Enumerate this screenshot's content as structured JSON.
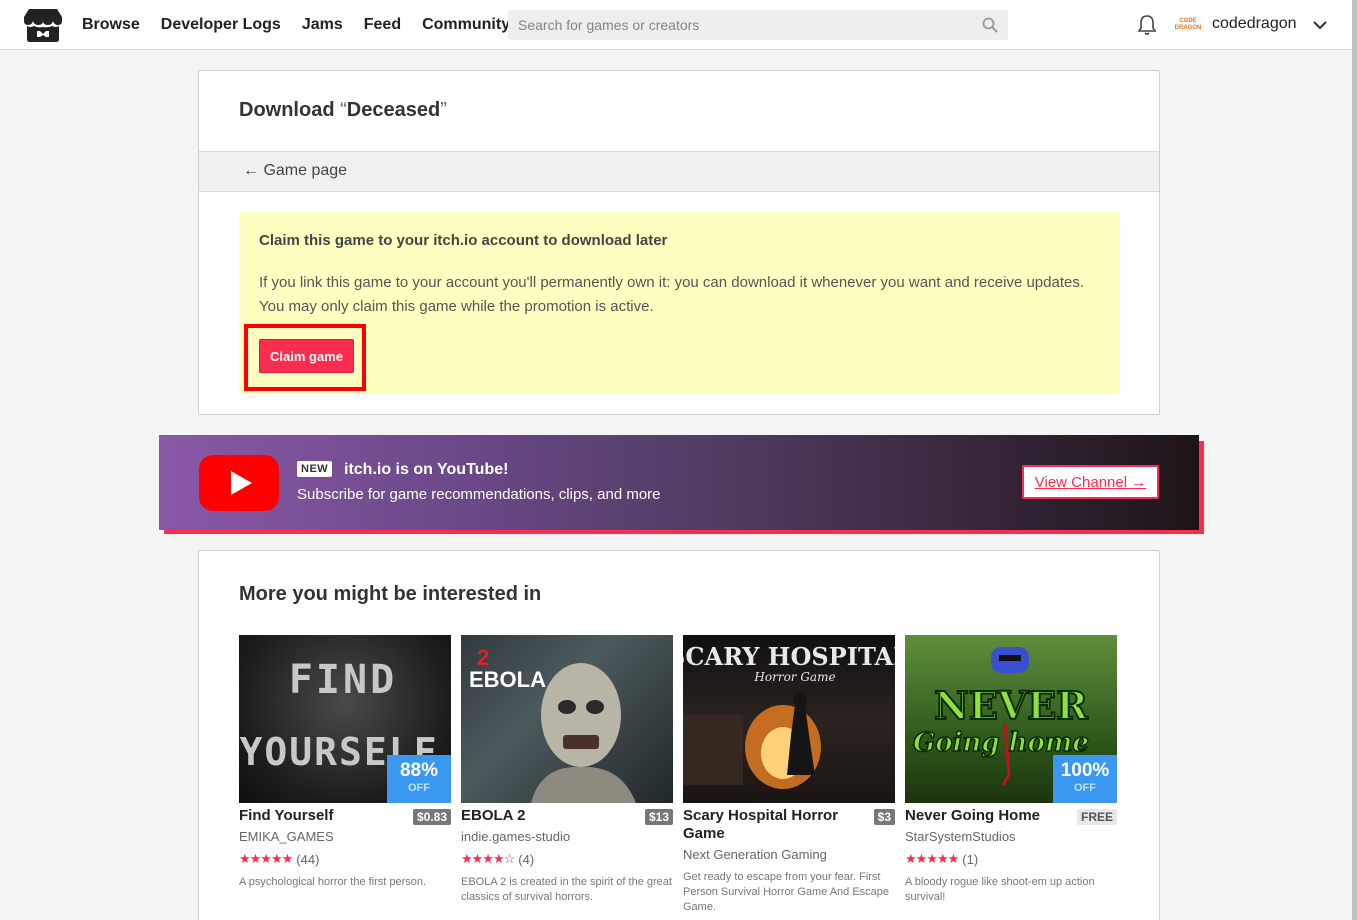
{
  "header": {
    "nav": [
      "Browse",
      "Developer Logs",
      "Jams",
      "Feed",
      "Community"
    ],
    "search_placeholder": "Search for games or creators",
    "avatar_text": [
      "CODE",
      "DRAGON"
    ],
    "username": "codedragon"
  },
  "download": {
    "title_prefix": "Download",
    "open_quote": "“",
    "game_name": "Deceased",
    "close_quote": "”",
    "back_link": "← Game page",
    "claim_heading": "Claim this game to your itch.io account to download later",
    "claim_text": "If you link this game to your account you'll permanently own it: you can download it whenever you want and receive updates. You may only claim this game while the promotion is active.",
    "claim_button": "Claim game"
  },
  "banner": {
    "badge": "NEW",
    "title": "itch.io is on YouTube!",
    "subtitle": "Subscribe for game recommendations, clips, and more",
    "button": "View Channel →"
  },
  "recommendations": {
    "heading": "More you might be interested in",
    "games": [
      {
        "title": "Find Yourself",
        "price": "$0.83",
        "author": "EMIKA_GAMES",
        "stars": "★★★★★",
        "count": "(44)",
        "desc": "A psychological horror the first person.",
        "sale_pct": "88%",
        "sale_off": "OFF",
        "art_text_1": "FIND",
        "art_text_2": "YOURSELF"
      },
      {
        "title": "EBOLA 2",
        "price": "$13",
        "author": "indie.games-studio",
        "stars": "★★★★☆",
        "count": "(4)",
        "desc": "EBOLA 2 is created in the spirit of the great classics of survival horrors.",
        "art_text_1": "2",
        "art_text_2": "EBOLA"
      },
      {
        "title": "Scary Hospital Horror Game",
        "price": "$3",
        "author": "Next Generation Gaming",
        "desc": "Get ready to escape from your fear. First Person Survival Horror Game And Escape Game.",
        "art_text_1": "SCARY HOSPITAL",
        "art_text_2": "Horror Game"
      },
      {
        "title": "Never Going Home",
        "price": "FREE",
        "author": "StarSystemStudios",
        "stars": "★★★★★",
        "count": "(1)",
        "desc": "A bloody rogue like shoot-em up action survival!",
        "sale_pct": "100%",
        "sale_off": "OFF",
        "art_text_1": "NEVER",
        "art_text_2": "Going home"
      }
    ]
  }
}
